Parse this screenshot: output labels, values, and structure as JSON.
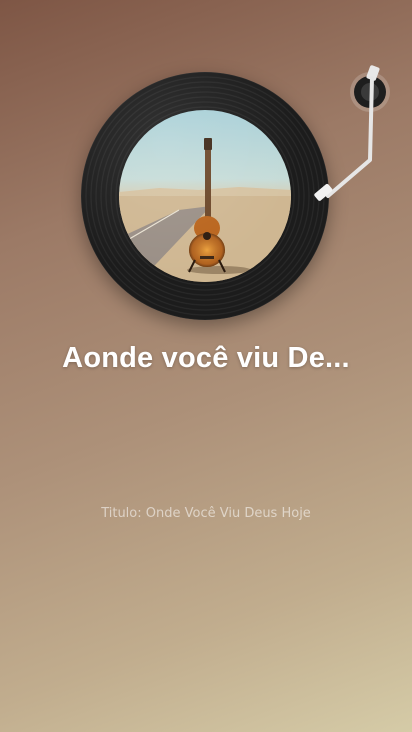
{
  "player": {
    "song_title": "Aonde você viu De...",
    "subtitle": "Titulo: Onde Você Viu Deus Hoje"
  },
  "icons": {
    "album_art": "guitar-desert-road",
    "tonearm": "turntable-tonearm"
  },
  "colors": {
    "background_top": "#7e5645",
    "background_bottom": "#d5cba7",
    "title_text": "#ffffff"
  }
}
